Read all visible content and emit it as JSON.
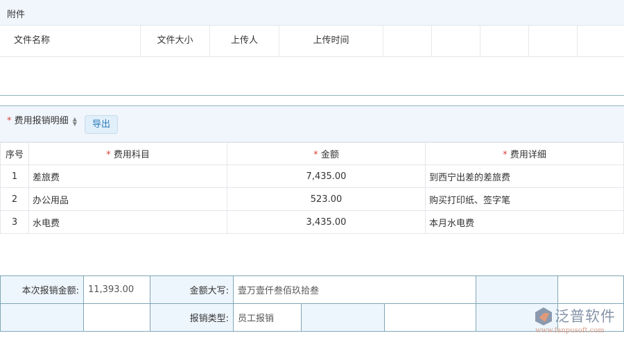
{
  "attachments": {
    "title": "附件",
    "columns": [
      "文件名称",
      "文件大小",
      "上传人",
      "上传时间",
      "",
      "",
      "",
      "",
      ""
    ]
  },
  "details": {
    "title": "费用报销明细",
    "export_label": "导出",
    "columns": [
      "序号",
      "费用科目",
      "金额",
      "费用详细"
    ],
    "rows": [
      {
        "no": "1",
        "category": "差旅费",
        "amount": "7,435.00",
        "detail": "到西宁出差的差旅费"
      },
      {
        "no": "2",
        "category": "办公用品",
        "amount": "523.00",
        "detail": "购买打印纸、签字笔"
      },
      {
        "no": "3",
        "category": "水电费",
        "amount": "3,435.00",
        "detail": "本月水电费"
      }
    ]
  },
  "summary": {
    "total_label": "本次报销金额:",
    "total_value": "11,393.00",
    "uppercase_label": "金额大写:",
    "uppercase_value": "壹万壹仟叁佰玖拾叁",
    "type_label": "报销类型:",
    "type_value": "员工报销"
  },
  "watermark": {
    "brand": "泛普软件",
    "url": "www.fanpusoft.com"
  }
}
